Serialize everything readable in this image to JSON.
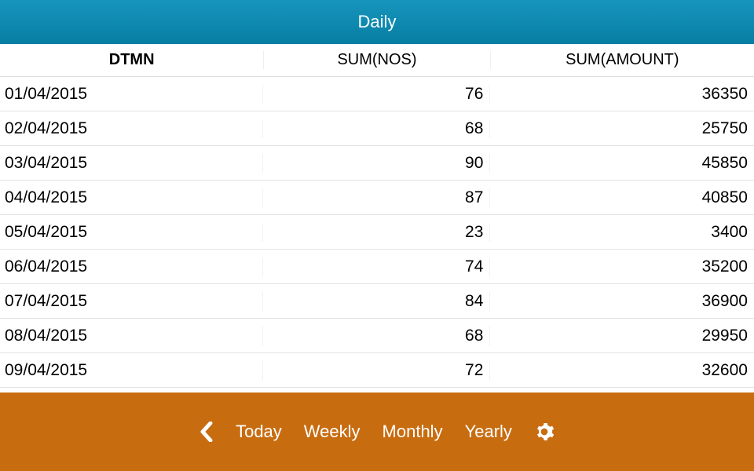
{
  "header": {
    "title": "Daily"
  },
  "columns": {
    "c1": "DTMN",
    "c2": "SUM(NOS)",
    "c3": "SUM(AMOUNT)"
  },
  "rows": [
    {
      "dtmn": "01/04/2015",
      "nos": "76",
      "amount": "36350"
    },
    {
      "dtmn": "02/04/2015",
      "nos": "68",
      "amount": "25750"
    },
    {
      "dtmn": "03/04/2015",
      "nos": "90",
      "amount": "45850"
    },
    {
      "dtmn": "04/04/2015",
      "nos": "87",
      "amount": "40850"
    },
    {
      "dtmn": "05/04/2015",
      "nos": "23",
      "amount": "3400"
    },
    {
      "dtmn": "06/04/2015",
      "nos": "74",
      "amount": "35200"
    },
    {
      "dtmn": "07/04/2015",
      "nos": "84",
      "amount": "36900"
    },
    {
      "dtmn": "08/04/2015",
      "nos": "68",
      "amount": "29950"
    },
    {
      "dtmn": "09/04/2015",
      "nos": "72",
      "amount": "32600"
    }
  ],
  "footer": {
    "today": "Today",
    "weekly": "Weekly",
    "monthly": "Monthly",
    "yearly": "Yearly"
  },
  "chart_data": {
    "type": "table",
    "columns": [
      "DTMN",
      "SUM(NOS)",
      "SUM(AMOUNT)"
    ],
    "rows": [
      [
        "01/04/2015",
        76,
        36350
      ],
      [
        "02/04/2015",
        68,
        25750
      ],
      [
        "03/04/2015",
        90,
        45850
      ],
      [
        "04/04/2015",
        87,
        40850
      ],
      [
        "05/04/2015",
        23,
        3400
      ],
      [
        "06/04/2015",
        74,
        35200
      ],
      [
        "07/04/2015",
        84,
        36900
      ],
      [
        "08/04/2015",
        68,
        29950
      ],
      [
        "09/04/2015",
        72,
        32600
      ]
    ]
  }
}
